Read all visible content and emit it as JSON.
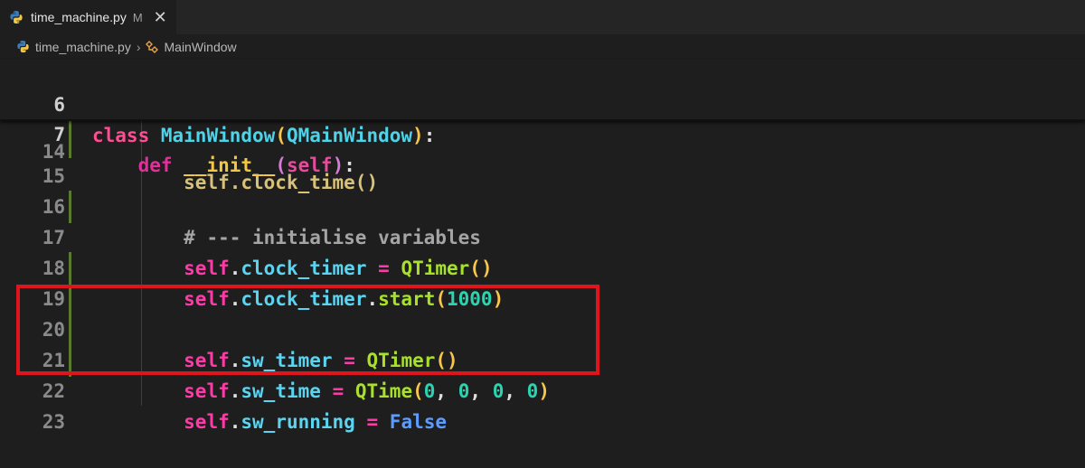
{
  "tab": {
    "filename": "time_machine.py",
    "status": "M",
    "icon": "python-icon"
  },
  "breadcrumb": {
    "file": "time_machine.py",
    "symbol": "MainWindow"
  },
  "sticky": [
    {
      "number": "6",
      "text": "class MainWindow(QMainWindow):"
    },
    {
      "number": "7",
      "text": "    def __init__(self):"
    }
  ],
  "lines": [
    {
      "number": "14",
      "text": "        self.clock_time()"
    },
    {
      "number": "15",
      "text": ""
    },
    {
      "number": "16",
      "text": "        # --- initialise variables"
    },
    {
      "number": "17",
      "text": "        self.clock_timer = QTimer()"
    },
    {
      "number": "18",
      "text": "        self.clock_timer.start(1000)"
    },
    {
      "number": "19",
      "text": ""
    },
    {
      "number": "20",
      "text": "        self.sw_timer = QTimer()"
    },
    {
      "number": "21",
      "text": "        self.sw_time = QTime(0, 0, 0, 0)"
    },
    {
      "number": "22",
      "text": "        self.sw_running = False"
    },
    {
      "number": "23",
      "text": ""
    }
  ],
  "highlight_color": "#e0141c"
}
